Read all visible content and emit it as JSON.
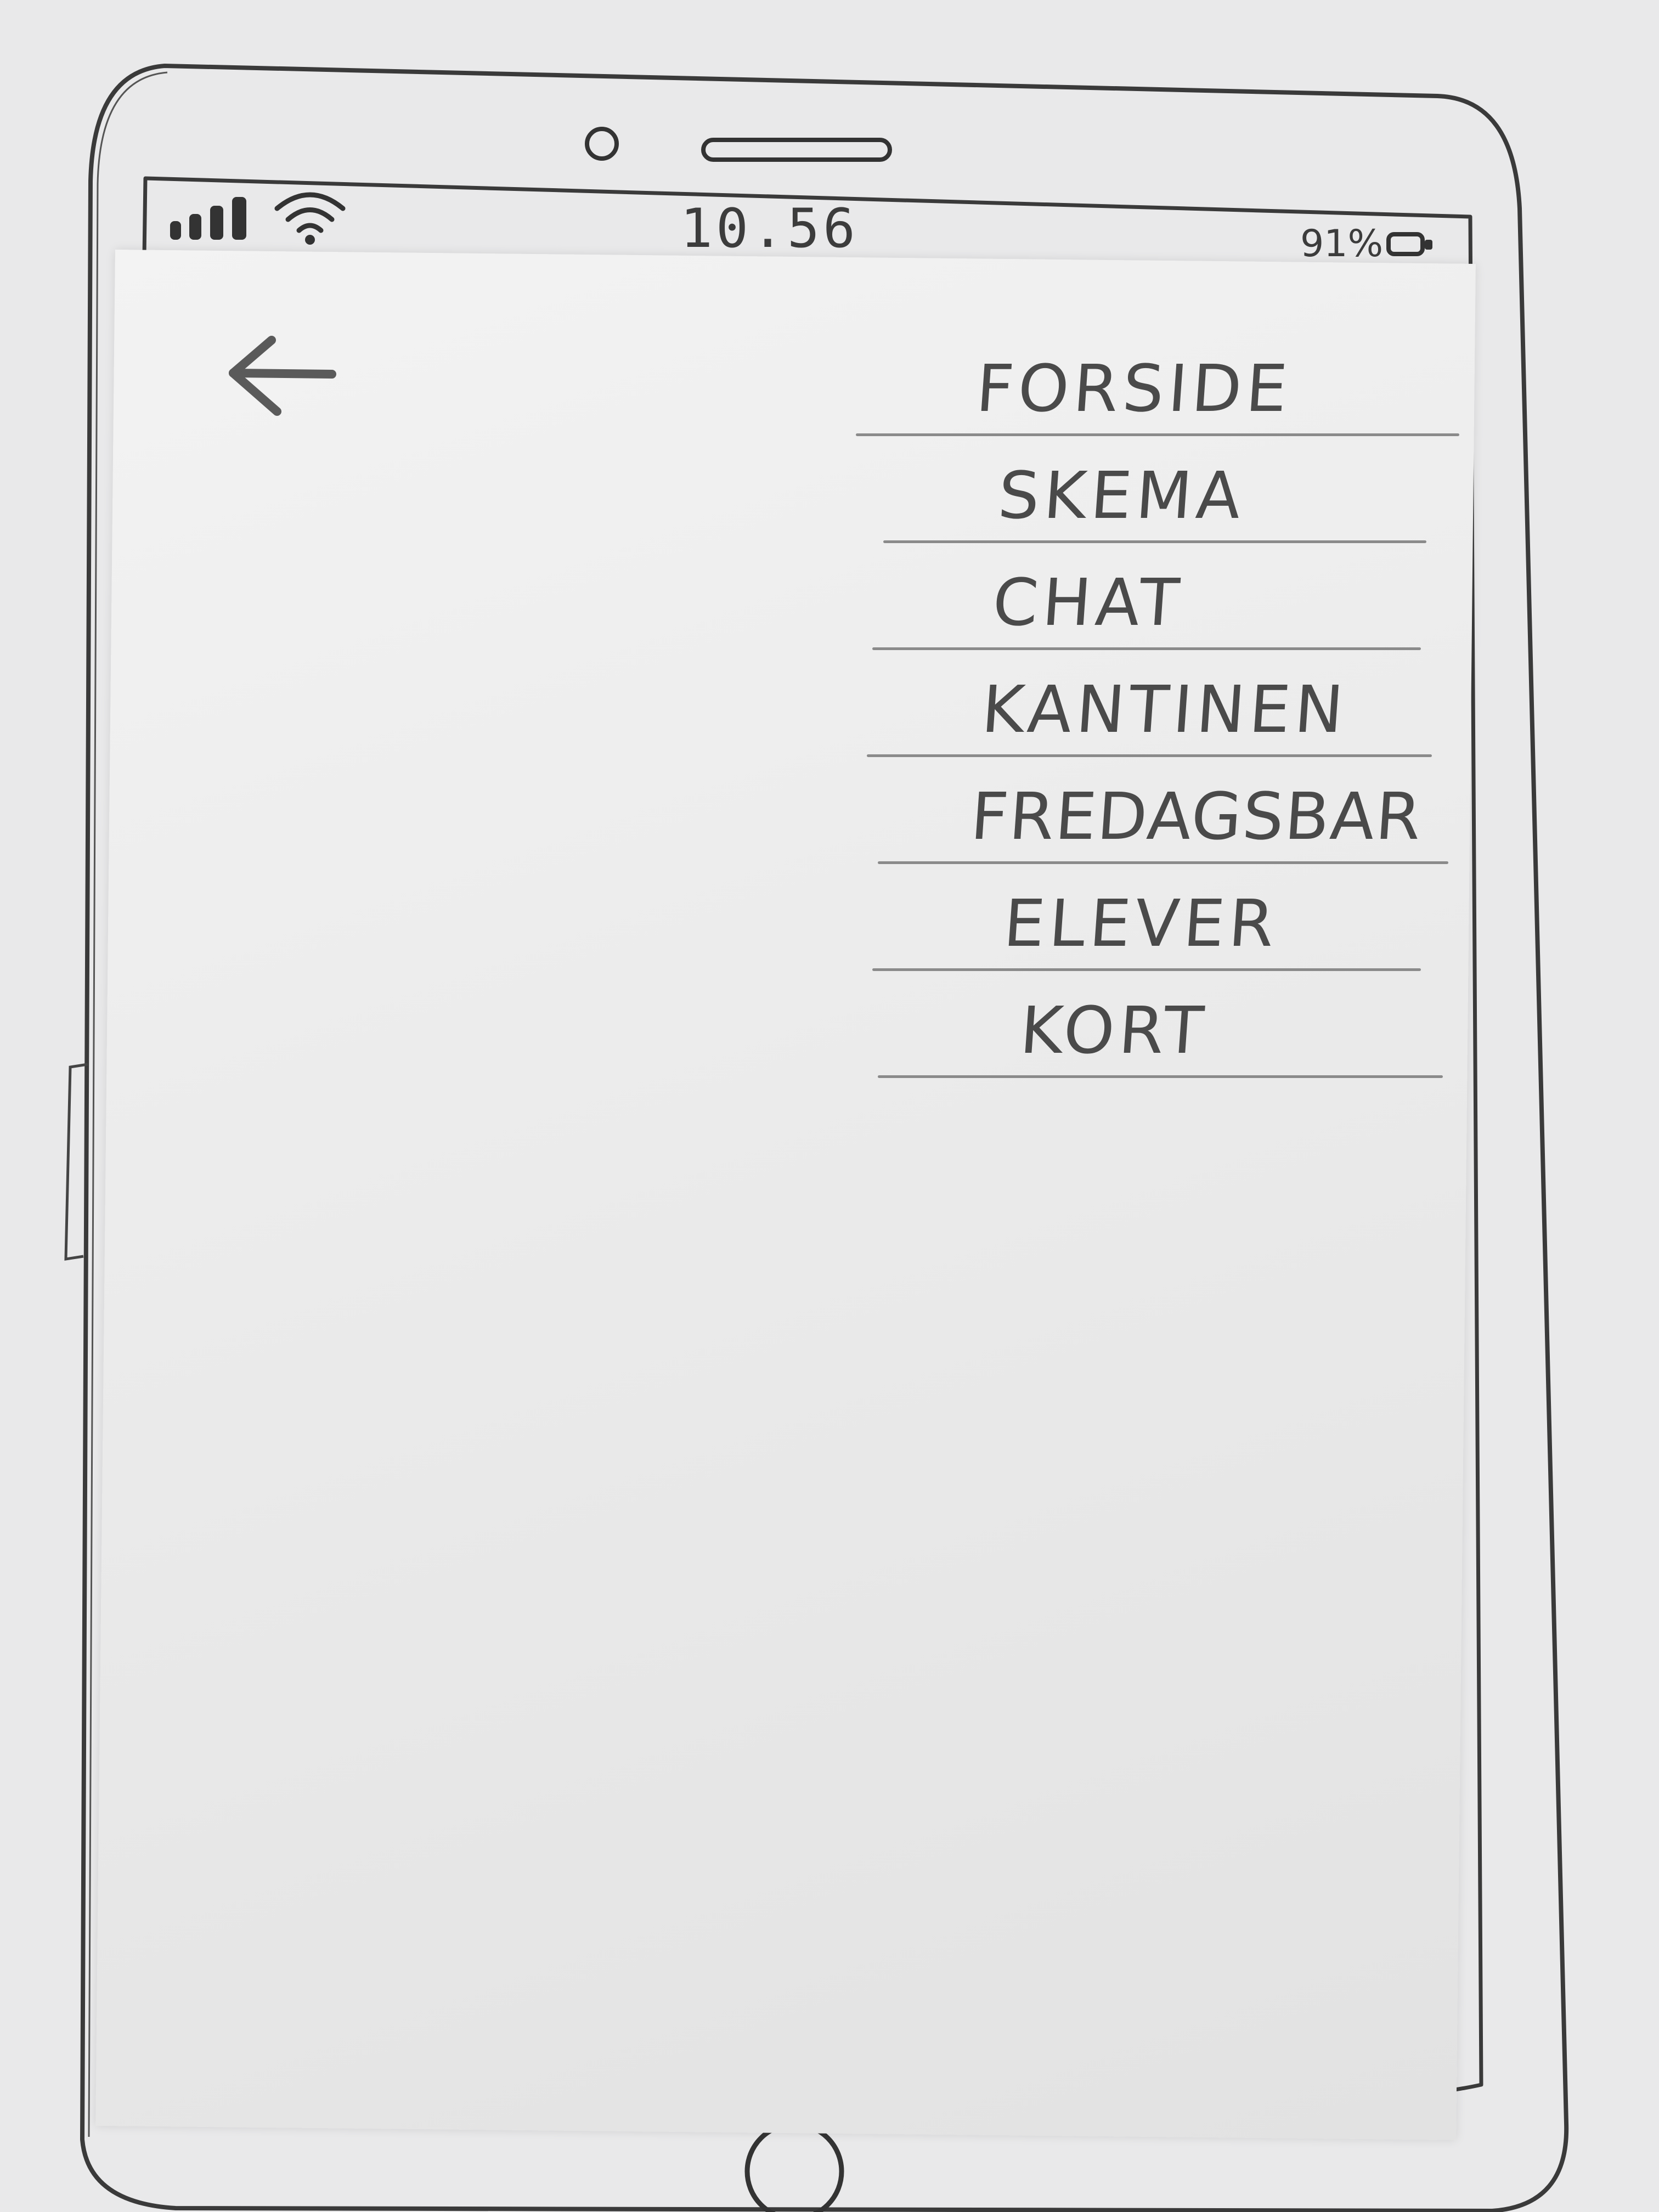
{
  "status_bar": {
    "time": "10.56",
    "battery": "91%"
  },
  "icons": {
    "back": "arrow-left-icon",
    "signal": "signal-bars-icon",
    "wifi": "wifi-icon",
    "battery": "battery-icon"
  },
  "menu": {
    "items": [
      {
        "label": "FORSIDE"
      },
      {
        "label": "SKEMA"
      },
      {
        "label": "CHAT"
      },
      {
        "label": "KANTINEN"
      },
      {
        "label": "FREDAGSBAR"
      },
      {
        "label": "ELEVER"
      },
      {
        "label": "KORT"
      }
    ]
  }
}
